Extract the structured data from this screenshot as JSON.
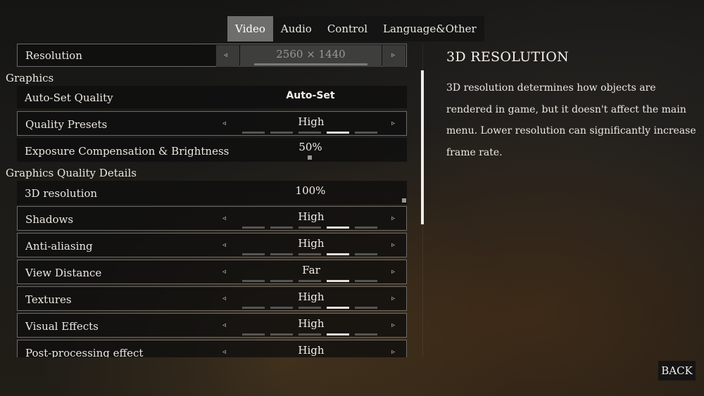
{
  "tabs": [
    {
      "label": "Video",
      "active": true
    },
    {
      "label": "Audio",
      "active": false
    },
    {
      "label": "Control",
      "active": false
    },
    {
      "label": "Language&Other",
      "active": false
    }
  ],
  "settings": {
    "resolution": {
      "label": "Resolution",
      "value": "2560 × 1440"
    },
    "graphics_header": "Graphics",
    "auto_set": {
      "label": "Auto-Set Quality",
      "button": "Auto-Set"
    },
    "quality_presets": {
      "label": "Quality Presets",
      "value": "High",
      "level": 4,
      "levels": 5
    },
    "exposure": {
      "label": "Exposure Compensation & Brightness",
      "value": "50%",
      "fraction": 0.5
    },
    "details_header": "Graphics Quality Details",
    "resolution_3d": {
      "label": "3D resolution",
      "value": "100%",
      "fraction": 1.0
    },
    "shadows": {
      "label": "Shadows",
      "value": "High",
      "level": 4,
      "levels": 5
    },
    "anti_aliasing": {
      "label": "Anti-aliasing",
      "value": "High",
      "level": 4,
      "levels": 5
    },
    "view_distance": {
      "label": "View Distance",
      "value": "Far",
      "level": 4,
      "levels": 5
    },
    "textures": {
      "label": "Textures",
      "value": "High",
      "level": 4,
      "levels": 5
    },
    "visual_effects": {
      "label": "Visual Effects",
      "value": "High",
      "level": 4,
      "levels": 5
    },
    "post_processing": {
      "label": "Post-processing effect",
      "value": "High"
    }
  },
  "icons": {
    "left_arrow": "◃",
    "right_arrow": "▹"
  },
  "info": {
    "title": "3D RESOLUTION",
    "description": "3D resolution determines how objects are rendered in game, but it doesn't affect the main menu. Lower resolution can significantly increase frame rate."
  },
  "back_label": "BACK",
  "colors": {
    "accent_tab": "#6e6e6c",
    "segment_on": "#e2e0da",
    "segment_off": "#555553"
  }
}
